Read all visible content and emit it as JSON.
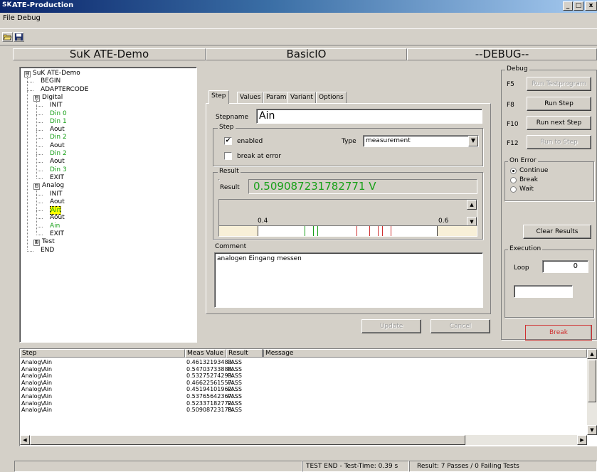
{
  "window": {
    "title": "ATE-Production",
    "icon": "SK",
    "controls": [
      "_",
      "□",
      "x"
    ]
  },
  "menu": [
    "File",
    "Debug"
  ],
  "toolbar": {
    "open_icon": "folder-open-icon",
    "save_icon": "save-icon"
  },
  "headers": [
    "SuK ATE-Demo",
    "BasicIO",
    "--DEBUG--"
  ],
  "tree": [
    {
      "label": "SuK ATE-Demo",
      "expander": "⊟",
      "color": "black"
    },
    {
      "label": "BEGIN",
      "color": "black"
    },
    {
      "label": "ADAPTERCODE",
      "color": "black"
    },
    {
      "label": "Digital",
      "expander": "⊟",
      "color": "black"
    },
    {
      "label": "INIT",
      "color": "black"
    },
    {
      "label": "Din 0",
      "color": "green"
    },
    {
      "label": "Din 1",
      "color": "green"
    },
    {
      "label": "Aout",
      "color": "black"
    },
    {
      "label": "Din 2",
      "color": "green"
    },
    {
      "label": "Aout",
      "color": "black"
    },
    {
      "label": "Din 2",
      "color": "green"
    },
    {
      "label": "Aout",
      "color": "black"
    },
    {
      "label": "Din 3",
      "color": "green"
    },
    {
      "label": "EXIT",
      "color": "black"
    },
    {
      "label": "Analog",
      "expander": "⊟",
      "color": "black"
    },
    {
      "label": "INIT",
      "color": "black"
    },
    {
      "label": "Aout",
      "color": "black"
    },
    {
      "label": "Ain",
      "color": "green",
      "selected": true
    },
    {
      "label": "Aout",
      "color": "black"
    },
    {
      "label": "Ain",
      "color": "green"
    },
    {
      "label": "EXIT",
      "color": "black"
    },
    {
      "label": "Test",
      "expander": "⊞",
      "color": "black"
    },
    {
      "label": "END",
      "color": "black"
    }
  ],
  "tabs": [
    "Step",
    "Values",
    "Param",
    "Variant",
    "Options"
  ],
  "step": {
    "stepname_label": "Stepname",
    "stepname_value": "Ain",
    "group_label": "Step",
    "enabled_label": "enabled",
    "enabled_checked": true,
    "break_label": "break at error",
    "break_checked": false,
    "type_label": "Type",
    "type_value": "measurement"
  },
  "result": {
    "group_label": "Result",
    "label": "Result",
    "value": "0.509087231782771 V",
    "scale_min": "0.4",
    "scale_max": "0.6"
  },
  "chart_data": {
    "type": "scatter",
    "title": "",
    "x": [
      0.46132193483,
      0.54703733888,
      0.53275274293,
      0.46622561557,
      0.45194101962,
      0.53765642367,
      0.52337182772,
      0.50908723178
    ],
    "xlim": [
      0.4,
      0.6
    ]
  },
  "comment": {
    "label": "Comment",
    "text": "analogen Eingang messen"
  },
  "buttons": {
    "update": "Update",
    "cancel": "Cancel"
  },
  "debug": {
    "group_label": "Debug",
    "keys": [
      {
        "key": "F5",
        "label": "Run Testprogram",
        "enabled": false
      },
      {
        "key": "F8",
        "label": "Run Step",
        "enabled": true
      },
      {
        "key": "F10",
        "label": "Run next Step",
        "enabled": true
      },
      {
        "key": "F12",
        "label": "Run to Step",
        "enabled": false
      }
    ],
    "on_error_label": "On Error",
    "on_error_options": [
      "Continue",
      "Break",
      "Wait"
    ],
    "on_error_selected": "Continue",
    "clear_results": "Clear Results",
    "execution_label": "Execution",
    "loop_label": "Loop",
    "loop_value": "0",
    "break_button": "Break"
  },
  "grid": {
    "columns": [
      "Step",
      "Meas Value",
      "Result",
      "Message"
    ],
    "rows": [
      [
        "Analog\\Ain",
        "0.46132193483...",
        "PASS",
        ""
      ],
      [
        "Analog\\Ain",
        "0.54703733888...",
        "PASS",
        ""
      ],
      [
        "Analog\\Ain",
        "0.53275274293...",
        "PASS",
        ""
      ],
      [
        "Analog\\Ain",
        "0.46622561557...",
        "PASS",
        ""
      ],
      [
        "Analog\\Ain",
        "0.45194101962...",
        "PASS",
        ""
      ],
      [
        "Analog\\Ain",
        "0.53765642367...",
        "PASS",
        ""
      ],
      [
        "Analog\\Ain",
        "0.52337182772...",
        "PASS",
        ""
      ],
      [
        "Analog\\Ain",
        "0.50908723178...",
        "PASS",
        ""
      ]
    ]
  },
  "status": {
    "left": "",
    "center": "TEST END - Test-Time: 0.39 s",
    "right": "Result: 7 Passes  / 0 Failing Tests"
  },
  "colors": {
    "title_start": "#0a246a",
    "title_end": "#a6caf0",
    "pass_green": "#18a018",
    "break_red": "#d03030",
    "selected_yellow": "#ffff00",
    "scale_band": "#f8f0d8"
  }
}
